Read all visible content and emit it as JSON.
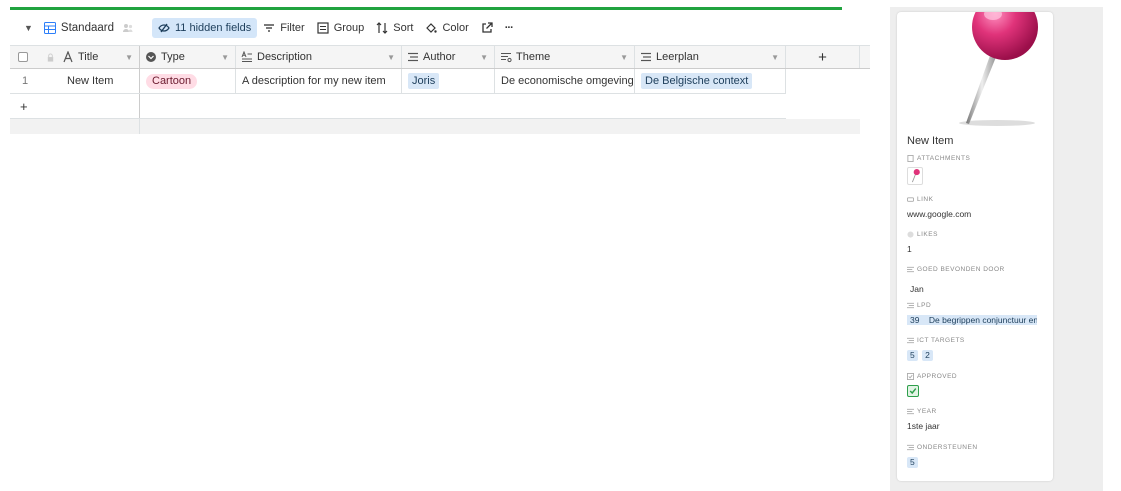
{
  "toolbar": {
    "view_name": "Standaard",
    "hidden_fields": "11 hidden fields",
    "filter": "Filter",
    "group": "Group",
    "sort": "Sort",
    "color": "Color",
    "more": "···"
  },
  "grid": {
    "columns": [
      {
        "name": "Title",
        "icon": "text-icon"
      },
      {
        "name": "Type",
        "icon": "single-select-icon"
      },
      {
        "name": "Description",
        "icon": "long-text-icon"
      },
      {
        "name": "Author",
        "icon": "multi-select-icon"
      },
      {
        "name": "Theme",
        "icon": "long-text-icon"
      },
      {
        "name": "Leerplan",
        "icon": "multi-select-icon"
      }
    ],
    "add_column": "+",
    "rows": [
      {
        "number": "1",
        "title": "New Item",
        "type": "Cartoon",
        "description": "A description for my new item",
        "author": "Joris",
        "theme": "De economische omgeving",
        "leerplan": "De Belgische context"
      }
    ],
    "add_row": "+"
  },
  "card": {
    "title": "New Item",
    "fields": {
      "attachments_label": "ATTACHMENTS",
      "link_label": "LINK",
      "link_value": "www.google.com",
      "likes_label": "LIKES",
      "likes_value": "1",
      "goed_label": "GOED BEVONDEN DOOR",
      "goed_value": "Jan",
      "lpd_label": "LPD",
      "lpd_num": "39",
      "lpd_text": "De begrippen conjunctuur en",
      "ict_label": "ICT TARGETS",
      "ict_values": [
        "5",
        "2"
      ],
      "approved_label": "APPROVED",
      "year_label": "YEAR",
      "year_value": "1ste jaar",
      "ondersteunen_label": "ONDERSTEUNEN",
      "ondersteunen_value": "5"
    }
  },
  "colors": {
    "progress": "#20a33f",
    "hidden_fields_bg": "#d4e6f9",
    "type_pill_bg": "#ffdce5",
    "chip_bg": "#d8e7f7",
    "pin_head": "#e0337a"
  }
}
